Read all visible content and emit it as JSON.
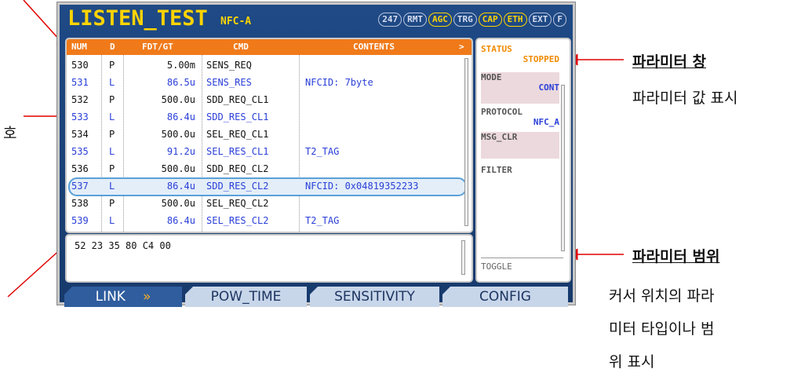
{
  "device": {
    "title": "LISTEN_TEST",
    "mode": "NFC-A",
    "indicators": [
      {
        "label": "247",
        "active": false
      },
      {
        "label": "RMT",
        "active": false
      },
      {
        "label": "AGC",
        "active": true
      },
      {
        "label": "TRG",
        "active": false
      },
      {
        "label": "CAP",
        "active": true
      },
      {
        "label": "ETH",
        "active": true
      },
      {
        "label": "EXT",
        "active": false
      },
      {
        "label": "F",
        "active": false
      }
    ]
  },
  "table": {
    "headers": {
      "num": "NUM",
      "d": "D",
      "fdt": "FDT/GT",
      "cmd": "CMD",
      "contents": "CONTENTS",
      "more": ">"
    },
    "rows": [
      {
        "num": "530",
        "d": "P",
        "fdt": "5.00m",
        "cmd": "SENS_REQ",
        "contents": "",
        "style": "black"
      },
      {
        "num": "531",
        "d": "L",
        "fdt": "86.5u",
        "cmd": "SENS_RES",
        "contents": "NFCID: 7byte",
        "style": "blue"
      },
      {
        "num": "532",
        "d": "P",
        "fdt": "500.0u",
        "cmd": "SDD_REQ_CL1",
        "contents": "",
        "style": "black"
      },
      {
        "num": "533",
        "d": "L",
        "fdt": "86.4u",
        "cmd": "SDD_RES_CL1",
        "contents": "",
        "style": "blue"
      },
      {
        "num": "534",
        "d": "P",
        "fdt": "500.0u",
        "cmd": "SEL_REQ_CL1",
        "contents": "",
        "style": "black"
      },
      {
        "num": "535",
        "d": "L",
        "fdt": "91.2u",
        "cmd": "SEL_RES_CL1",
        "contents": "T2_TAG",
        "style": "blue"
      },
      {
        "num": "536",
        "d": "P",
        "fdt": "500.0u",
        "cmd": "SDD_REQ_CL2",
        "contents": "",
        "style": "black"
      },
      {
        "num": "537",
        "d": "L",
        "fdt": "86.4u",
        "cmd": "SDD_RES_CL2",
        "contents": "NFCID: 0x04819352233",
        "style": "blue",
        "selected": true
      },
      {
        "num": "538",
        "d": "P",
        "fdt": "500.0u",
        "cmd": "SEL_REQ_CL2",
        "contents": "",
        "style": "black"
      },
      {
        "num": "539",
        "d": "L",
        "fdt": "86.4u",
        "cmd": "SEL_RES_CL2",
        "contents": "T2_TAG",
        "style": "blue"
      }
    ]
  },
  "hex": {
    "value": "52 23 35 80 C4 00"
  },
  "params": {
    "status_label": "STATUS",
    "status_value": "STOPPED",
    "mode_label": "MODE",
    "mode_value": "CONT",
    "protocol_label": "PROTOCOL",
    "protocol_value": "NFC_A",
    "msg_clr_label": "MSG_CLR",
    "filter_label": "FILTER",
    "toggle_label": "TOGGLE"
  },
  "tabs": [
    {
      "label": "LINK",
      "active": true,
      "marker": "»"
    },
    {
      "label": "POW_TIME",
      "active": false
    },
    {
      "label": "SENSITIVITY",
      "active": false
    },
    {
      "label": "CONFIG",
      "active": false
    }
  ],
  "annotations": {
    "param_window_title": "파라미터 창",
    "param_window_desc": "파라미터 값 표시",
    "param_range_title": "파라미터 범위",
    "param_range_desc_1": "커서 위치의 파라",
    "param_range_desc_2": "미터 타입이나 범",
    "param_range_desc_3": "위 표시",
    "left_fragment": "호"
  },
  "colors": {
    "screen_bg": "#1f4a86",
    "title_yellow": "#ffd400",
    "header_orange": "#f07a1a",
    "row_blue": "#2a3fd8",
    "tab_active": "#2f5d9e",
    "arrow_red": "#e00000"
  }
}
